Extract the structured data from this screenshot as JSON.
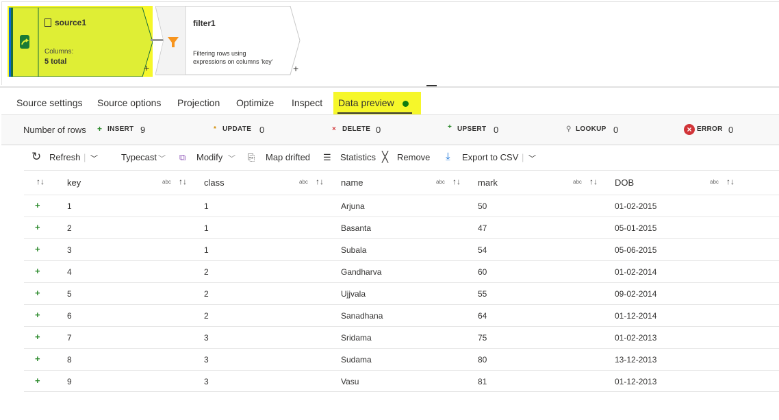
{
  "pipeline": {
    "source": {
      "title": "source1",
      "columns_label": "Columns:",
      "columns_value": "5 total",
      "add": "+"
    },
    "filter": {
      "title": "filter1",
      "description_line1": "Filtering rows using",
      "description_line2": "expressions on columns 'key'",
      "add": "+"
    },
    "highlight_color": "#f6f72a"
  },
  "tabs": [
    {
      "label": "Source settings"
    },
    {
      "label": "Source options"
    },
    {
      "label": "Projection"
    },
    {
      "label": "Optimize"
    },
    {
      "label": "Inspect"
    },
    {
      "label": "Data preview",
      "active": true,
      "status_color": "#107c10"
    }
  ],
  "stats": {
    "label": "Number of rows",
    "insert": {
      "label": "INSERT",
      "value": "9"
    },
    "update": {
      "label": "UPDATE",
      "value": "0"
    },
    "delete": {
      "label": "DELETE",
      "value": "0"
    },
    "upsert": {
      "label": "UPSERT",
      "value": "0"
    },
    "lookup": {
      "label": "LOOKUP",
      "value": "0"
    },
    "error": {
      "label": "ERROR",
      "value": "0"
    }
  },
  "toolbar": {
    "refresh": "Refresh",
    "typecast": "Typecast",
    "modify": "Modify",
    "map_drifted": "Map drifted",
    "statistics": "Statistics",
    "remove": "Remove",
    "export": "Export to CSV"
  },
  "table": {
    "type_label": "abc",
    "columns": [
      "key",
      "class",
      "name",
      "mark",
      "DOB"
    ],
    "rows": [
      [
        "1",
        "1",
        "Arjuna",
        "50",
        "01-02-2015"
      ],
      [
        "2",
        "1",
        "Basanta",
        "47",
        "05-01-2015"
      ],
      [
        "3",
        "1",
        "Subala",
        "54",
        "05-06-2015"
      ],
      [
        "4",
        "2",
        "Gandharva",
        "60",
        "01-02-2014"
      ],
      [
        "5",
        "2",
        "Ujjvala",
        "55",
        "09-02-2014"
      ],
      [
        "6",
        "2",
        "Sanadhana",
        "64",
        "01-12-2014"
      ],
      [
        "7",
        "3",
        "Sridama",
        "75",
        "01-02-2013"
      ],
      [
        "8",
        "3",
        "Sudama",
        "80",
        "13-12-2013"
      ],
      [
        "9",
        "3",
        "Vasu",
        "81",
        "01-12-2013"
      ]
    ]
  }
}
